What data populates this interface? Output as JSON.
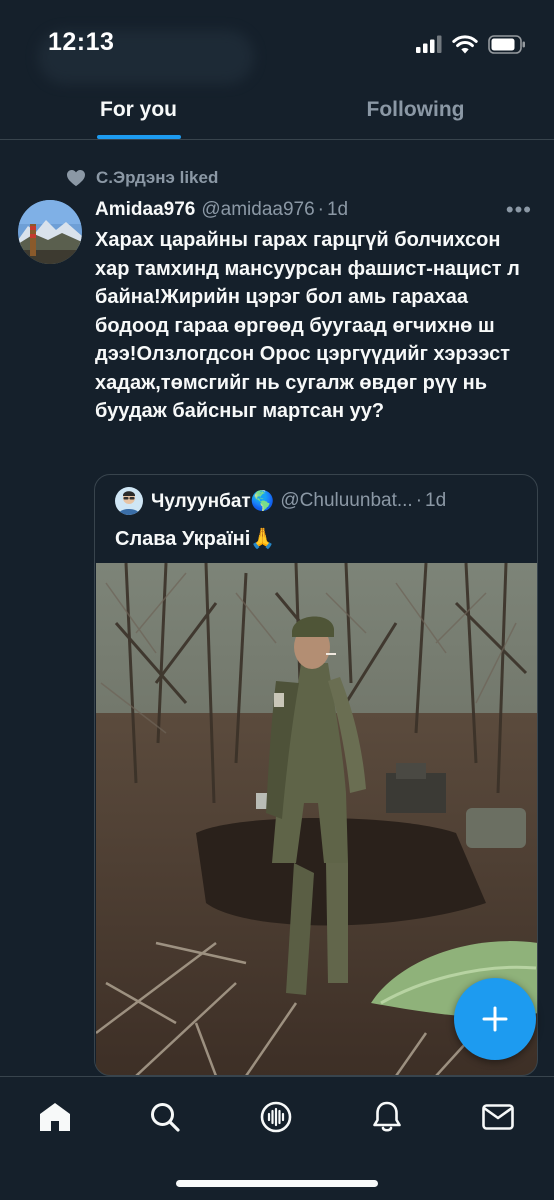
{
  "status_bar": {
    "time": "12:13"
  },
  "tabs": [
    {
      "label": "For you"
    },
    {
      "label": "Following"
    }
  ],
  "tweet": {
    "social_context": "С.Эрдэнэ liked",
    "display_name": "Amidaa976",
    "handle": "@amidaa976",
    "separator": "·",
    "time": "1d",
    "more_label": "•••",
    "text": "Харах царайны гарах гарцгүй болчихсон хар тамхинд мансуурсан фашист-нацист л байна!Жирийн цэрэг бол амь гарахаа бодоод гараа өргөөд буугаад өгчихнө ш дээ!Олзлогдсон Орос цэргүүдийг хэрээст хадаж,төмсгийг нь сугалж өвдөг рүү нь буудаж байсныг мартсан уу?",
    "quote": {
      "display_name": "Чулуунбат🌎",
      "handle": "@Chuluunbat...",
      "separator": "·",
      "time": "1d",
      "text": "Слава Україні🙏"
    }
  },
  "colors": {
    "background": "#15202b",
    "accent": "#1d9bf0",
    "secondary_text": "#8b98a5",
    "border": "#38444d"
  },
  "icons": {
    "nav": [
      "home-icon",
      "search-icon",
      "spaces-icon",
      "notifications-icon",
      "messages-icon"
    ],
    "fab": "plus-icon",
    "context": "heart-icon",
    "status": [
      "signal-icon",
      "wifi-icon",
      "battery-icon"
    ]
  }
}
